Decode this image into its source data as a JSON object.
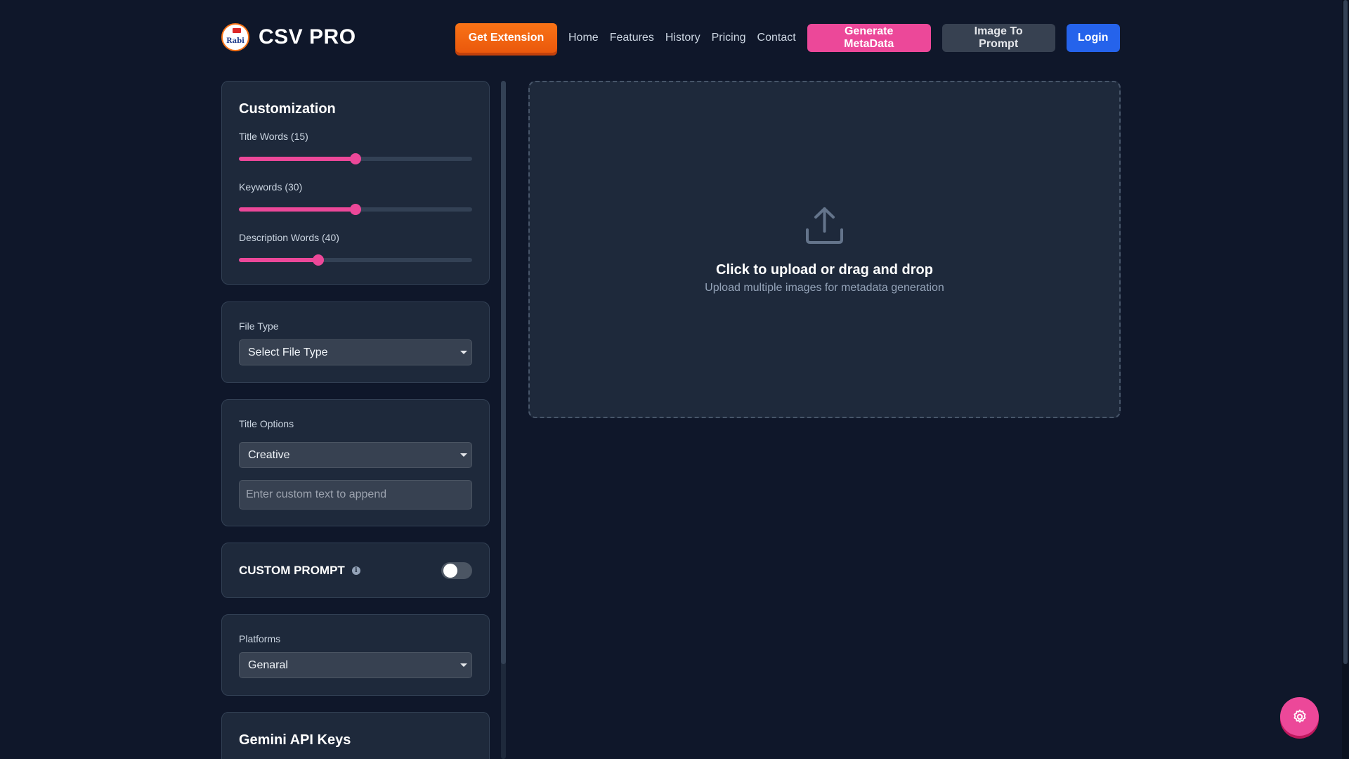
{
  "header": {
    "logo_text": "CSV PRO",
    "logo_badge_text": "Rabi",
    "get_extension_label": "Get Extension",
    "nav_links": [
      "Home",
      "Features",
      "History",
      "Pricing",
      "Contact"
    ],
    "generate_metadata_label": "Generate MetaData",
    "image_to_prompt_label": "Image To Prompt",
    "login_label": "Login"
  },
  "customization": {
    "title": "Customization",
    "sliders": [
      {
        "label": "Title Words (15)",
        "value": 15,
        "fraction": 0.5
      },
      {
        "label": "Keywords (30)",
        "value": 30,
        "fraction": 0.5
      },
      {
        "label": "Description Words (40)",
        "value": 40,
        "fraction": 0.34
      }
    ]
  },
  "file_type": {
    "label": "File Type",
    "selected": "Select File Type"
  },
  "title_options": {
    "label": "Title Options",
    "selected": "Creative",
    "custom_text_placeholder": "Enter custom text to append"
  },
  "custom_prompt": {
    "label": "CUSTOM PROMPT",
    "enabled": false
  },
  "platforms": {
    "label": "Platforms",
    "selected": "Genaral"
  },
  "gemini": {
    "title": "Gemini API Keys"
  },
  "upload": {
    "title": "Click to upload or drag and drop",
    "subtitle": "Upload multiple images for metadata generation"
  },
  "colors": {
    "accent": "#ec4899",
    "extension": "#f97316",
    "login": "#2563eb",
    "background": "#0f172a",
    "card": "#1e293b"
  },
  "icons": {
    "upload": "upload-icon",
    "settings": "gear-icon",
    "info": "info-icon"
  }
}
